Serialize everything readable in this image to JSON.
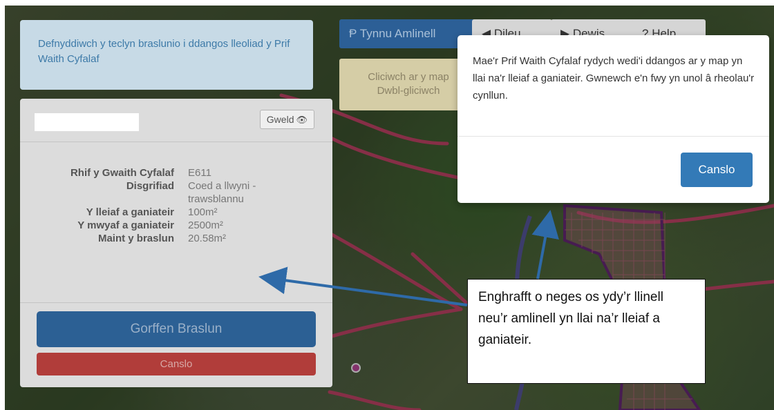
{
  "info": {
    "text": "Defnyddiwch y teclyn braslunio i ddangos lleoliad y Prif Waith Cyfalaf"
  },
  "panel": {
    "view_button": "Gweld",
    "properties": [
      {
        "label": "Rhif y Gwaith Cyfalaf",
        "value": "E611"
      },
      {
        "label": "Disgrifiad",
        "value": "Coed a llwyni - trawsblannu"
      },
      {
        "label": "Y lleiaf a ganiateir",
        "value": "100m²"
      },
      {
        "label": "Y mwyaf a ganiateir",
        "value": "2500m²"
      },
      {
        "label": "Maint y braslun",
        "value": "20.58m²"
      }
    ],
    "finish_button": "Gorffen Braslun",
    "cancel_button": "Canslo"
  },
  "toolbar": {
    "draw_label": "Tynnu Amlinell",
    "btn2_label": "Dileu",
    "btn3_label": "Dewis",
    "btn4_label": "Help"
  },
  "hint": {
    "line1": "Cliciwch ar y map",
    "line2": "Dwbl-gliciwch"
  },
  "modal": {
    "message": "Mae'r Prif Waith Cyfalaf rydych wedi'i ddangos ar y map yn llai na'r lleiaf a ganiateir. Gwnewch e'n fwy yn unol â rheolau'r cynllun.",
    "cancel_label": "Canslo"
  },
  "callout": {
    "text": "Enghrafft o neges os ydy’r llinell neu’r amlinell yn llai na’r lleiaf a ganiateir."
  },
  "colors": {
    "primary": "#337ab7",
    "danger": "#b13d3a",
    "boundary": "#c8476a",
    "parcel": "#6a2a7a",
    "arrow": "#2e6aa8"
  }
}
